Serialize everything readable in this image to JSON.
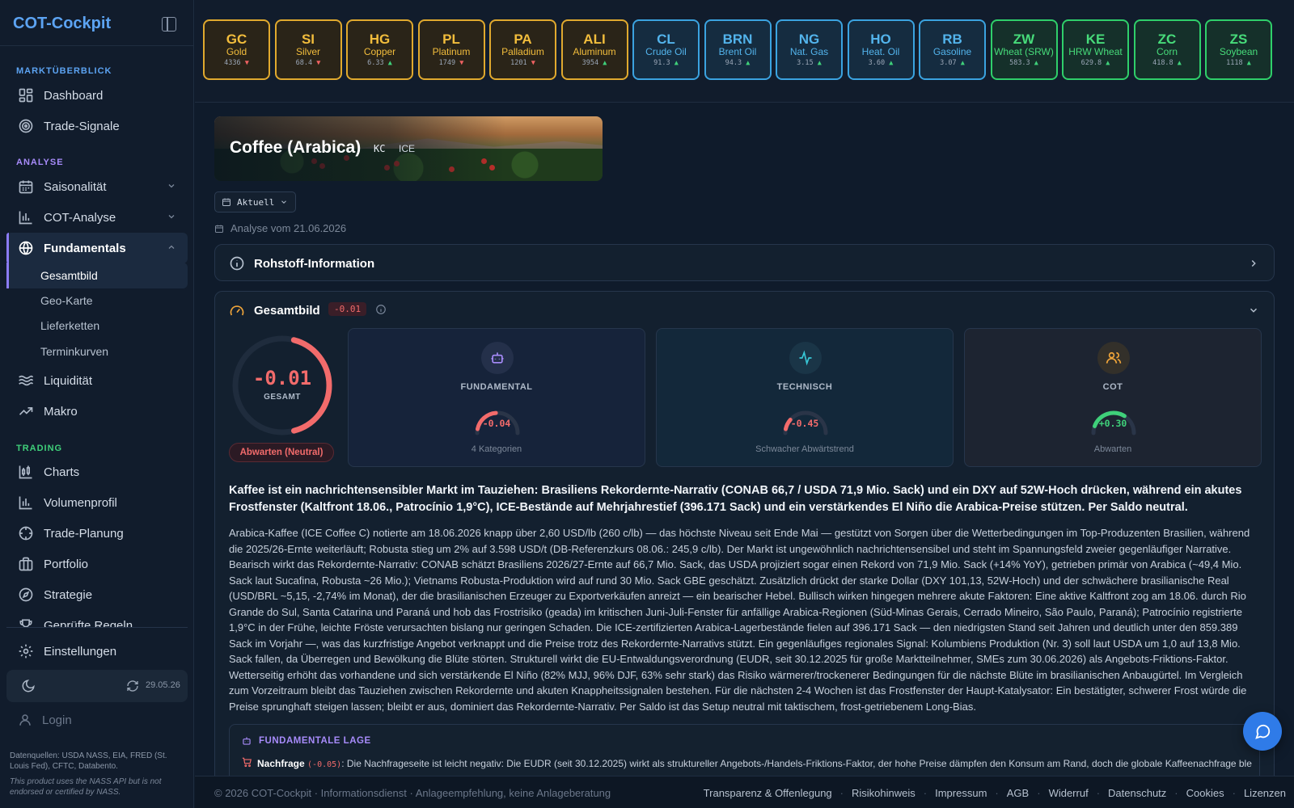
{
  "sidebar": {
    "brand": "COT-Cockpit",
    "sections": {
      "markt": "MARKTÜBERBLICK",
      "analyse": "ANALYSE",
      "trading": "TRADING"
    },
    "items": {
      "dashboard": "Dashboard",
      "signale": "Trade-Signale",
      "saison": "Saisonalität",
      "cot": "COT-Analyse",
      "fund": "Fundamentals",
      "gesamtbild": "Gesamtbild",
      "geokarte": "Geo-Karte",
      "lieferketten": "Lieferketten",
      "terminkurven": "Terminkurven",
      "liquiditaet": "Liquidität",
      "makro": "Makro",
      "charts": "Charts",
      "volumen": "Volumenprofil",
      "planung": "Trade-Planung",
      "portfolio": "Portfolio",
      "strategie": "Strategie",
      "regeln": "Geprüfte Regeln",
      "einstellungen": "Einstellungen",
      "login": "Login"
    },
    "sync_date": "29.05.26",
    "sources": "Datenquellen: USDA NASS, EIA, FRED (St. Louis Fed), CFTC, Databento.",
    "nass": "This product uses the NASS API but is not endorsed or certified by NASS."
  },
  "ticker": [
    {
      "sym": "GC",
      "name": "Gold",
      "price": "4336",
      "dir": "down",
      "group": "metal"
    },
    {
      "sym": "SI",
      "name": "Silver",
      "price": "68.4",
      "dir": "down",
      "group": "metal"
    },
    {
      "sym": "HG",
      "name": "Copper",
      "price": "6.33",
      "dir": "up",
      "group": "metal"
    },
    {
      "sym": "PL",
      "name": "Platinum",
      "price": "1749",
      "dir": "down",
      "group": "metal"
    },
    {
      "sym": "PA",
      "name": "Palladium",
      "price": "1201",
      "dir": "down",
      "group": "metal"
    },
    {
      "sym": "ALI",
      "name": "Aluminum",
      "price": "3954",
      "dir": "up",
      "group": "metal"
    },
    {
      "sym": "CL",
      "name": "Crude Oil",
      "price": "91.3",
      "dir": "up",
      "group": "energy"
    },
    {
      "sym": "BRN",
      "name": "Brent Oil",
      "price": "94.3",
      "dir": "up",
      "group": "energy"
    },
    {
      "sym": "NG",
      "name": "Nat. Gas",
      "price": "3.15",
      "dir": "up",
      "group": "energy"
    },
    {
      "sym": "HO",
      "name": "Heat. Oil",
      "price": "3.60",
      "dir": "up",
      "group": "energy"
    },
    {
      "sym": "RB",
      "name": "Gasoline",
      "price": "3.07",
      "dir": "up",
      "group": "energy"
    },
    {
      "sym": "ZW",
      "name": "Wheat (SRW)",
      "price": "583.3",
      "dir": "up",
      "group": "grain"
    },
    {
      "sym": "KE",
      "name": "HRW Wheat",
      "price": "629.8",
      "dir": "up",
      "group": "grain"
    },
    {
      "sym": "ZC",
      "name": "Corn",
      "price": "418.8",
      "dir": "up",
      "group": "grain"
    },
    {
      "sym": "ZS",
      "name": "Soybean",
      "price": "1118",
      "dir": "up",
      "group": "grain"
    }
  ],
  "arrows": {
    "up": "▲",
    "down": "▼"
  },
  "hero": {
    "title": "Coffee (Arabica)",
    "code": "KC",
    "exchange": "ICE"
  },
  "version_select": "Aktuell",
  "analysis_date": "Analyse vom 21.06.2026",
  "info_section": "Rohstoff-Information",
  "gesamtbild": {
    "title": "Gesamtbild",
    "badge": "-0.01",
    "total_value": "-0.01",
    "total_value_num": -0.01,
    "total_label": "GESAMT",
    "status": "Abwarten (Neutral)",
    "cards": {
      "fundamental": {
        "label": "FUNDAMENTAL",
        "value": "-0.04",
        "value_num": -0.04,
        "desc": "4 Kategorien"
      },
      "technisch": {
        "label": "TECHNISCH",
        "value": "-0.45",
        "value_num": -0.45,
        "desc": "Schwacher Abwärtstrend"
      },
      "cot": {
        "label": "COT",
        "value": "+0.30",
        "value_num": 0.3,
        "desc": "Abwarten"
      }
    },
    "headline": "Kaffee ist ein nachrichtensensibler Markt im Tauziehen: Brasiliens Rekordernte-Narrativ (CONAB 66,7 / USDA 71,9 Mio. Sack) und ein DXY auf 52W-Hoch drücken, während ein akutes Frostfenster (Kaltfront 18.06., Patrocínio 1,9°C), ICE-Bestände auf Mehrjahrestief (396.171 Sack) und ein verstärkendes El Niño die Arabica-Preise stützen. Per Saldo neutral.",
    "body": "Arabica-Kaffee (ICE Coffee C) notierte am 18.06.2026 knapp über 2,60 USD/lb (260 c/lb) — das höchste Niveau seit Ende Mai — gestützt von Sorgen über die Wetterbedingungen im Top-Produzenten Brasilien, während die 2025/26-Ernte weiterläuft; Robusta stieg um 2% auf 3.598 USD/t (DB-Referenzkurs 08.06.: 245,9 c/lb). Der Markt ist ungewöhnlich nachrichtensensibel und steht im Spannungsfeld zweier gegenläufiger Narrative. Bearisch wirkt das Rekordernte-Narrativ: CONAB schätzt Brasiliens 2026/27-Ernte auf 66,7 Mio. Sack, das USDA projiziert sogar einen Rekord von 71,9 Mio. Sack (+14% YoY), getrieben primär von Arabica (~49,4 Mio. Sack laut Sucafina, Robusta ~26 Mio.); Vietnams Robusta-Produktion wird auf rund 30 Mio. Sack GBE geschätzt. Zusätzlich drückt der starke Dollar (DXY 101,13, 52W-Hoch) und der schwächere brasilianische Real (USD/BRL ~5,15, -2,74% im Monat), der die brasilianischen Erzeuger zu Exportverkäufen anreizt — ein bearischer Hebel. Bullisch wirken hingegen mehrere akute Faktoren: Eine aktive Kaltfront zog am 18.06. durch Rio Grande do Sul, Santa Catarina und Paraná und hob das Frostrisiko (geada) im kritischen Juni-Juli-Fenster für anfällige Arabica-Regionen (Süd-Minas Gerais, Cerrado Mineiro, São Paulo, Paraná); Patrocínio registrierte 1,9°C in der Frühe, leichte Fröste verursachten bislang nur geringen Schaden. Die ICE-zertifizierten Arabica-Lagerbestände fielen auf 396.171 Sack — den niedrigsten Stand seit Jahren und deutlich unter den 859.389 Sack im Vorjahr —, was das kurzfristige Angebot verknappt und die Preise trotz des Rekordernte-Narrativs stützt. Ein gegenläufiges regionales Signal: Kolumbiens Produktion (Nr. 3) soll laut USDA um 1,0 auf 13,8 Mio. Sack fallen, da Überregen und Bewölkung die Blüte störten. Strukturell wirkt die EU-Entwaldungsverordnung (EUDR, seit 30.12.2025 für große Marktteilnehmer, SMEs zum 30.06.2026) als Angebots-Friktions-Faktor. Wetterseitig erhöht das vorhandene und sich verstärkende El Niño (82% MJJ, 96% DJF, 63% sehr stark) das Risiko wärmerer/trockenerer Bedingungen für die nächste Blüte im brasilianischen Anbaugürtel. Im Vergleich zum Vorzeitraum bleibt das Tauziehen zwischen Rekordernte und akuten Knappheitssignalen bestehen. Für die nächsten 2-4 Wochen ist das Frostfenster der Haupt-Katalysator: Ein bestätigter, schwerer Frost würde die Preise sprunghaft steigen lassen; bleibt er aus, dominiert das Rekordernte-Narrativ. Per Saldo ist das Setup neutral mit taktischem, frost-getriebenem Long-Bias.",
    "fund_lage": {
      "title": "FUNDAMENTALE LAGE",
      "nachfrage_label": "Nachfrage",
      "nachfrage_score": "(-0.05)",
      "nachfrage_text": ": Die Nachfrageseite ist leicht negativ: Die EUDR (seit 30.12.2025) wirkt als struktureller Angebots-/Handels-Friktions-Faktor, der hohe Preise dämpfen den Konsum am Rand, doch die globale Kaffeenachfrage bleibt"
    }
  },
  "footer": {
    "copy": "© 2026 COT-Cockpit · Informationsdienst · Anlageempfehlung, keine Anlageberatung",
    "links": [
      "Transparenz & Offenlegung",
      "Risikohinweis",
      "Impressum",
      "AGB",
      "Widerruf",
      "Datenschutz",
      "Cookies",
      "Lizenzen"
    ]
  },
  "colors": {
    "accent": "#5ca3f2",
    "negative": "#f26b6b",
    "positive": "#3fd07a",
    "metal": "#e0a92e",
    "energy": "#3ba3e0",
    "grain": "#2fcf6a"
  }
}
